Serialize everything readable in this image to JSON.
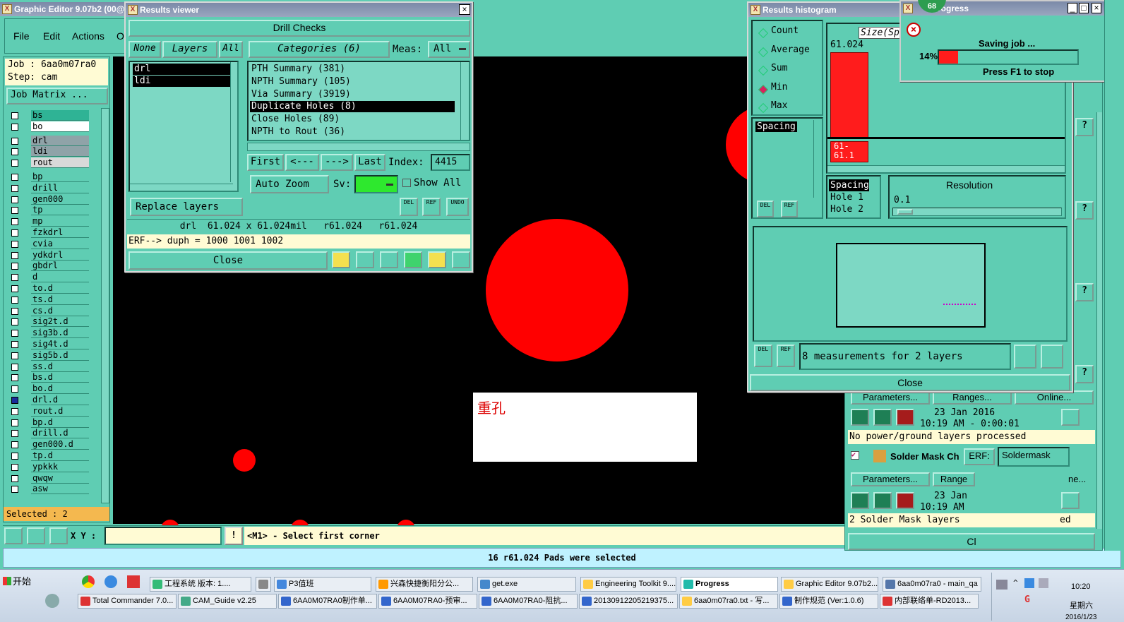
{
  "editor": {
    "title": "Graphic Editor 9.07b2 (00@",
    "menu": [
      "File",
      "Edit",
      "Actions",
      "O"
    ],
    "job_label": "Job : 6aa0m07ra0",
    "step_label": "Step: cam",
    "job_matrix": "Job Matrix ...",
    "layers": [
      "bs",
      "bo",
      "drl",
      "ldi",
      "rout",
      "bp",
      "drill",
      "gen000",
      "tp",
      "mp",
      "fzkdrl",
      "cvia",
      "ydkdrl",
      "gbdrl",
      "d",
      "to.d",
      "ts.d",
      "cs.d",
      "sig2t.d",
      "sig3b.d",
      "sig4t.d",
      "sig5b.d",
      "ss.d",
      "bs.d",
      "bo.d",
      "drl.d",
      "rout.d",
      "bp.d",
      "drill.d",
      "gen000.d",
      "tp.d",
      "ypkkk",
      "qwqw",
      "asw"
    ],
    "selected": "Selected : 2",
    "xy_label": "X Y :",
    "prompt": "<M1> - Select first corner",
    "status": "16 r61.024 Pads were selected",
    "note_text": "重孔"
  },
  "results_viewer": {
    "title": "Results viewer",
    "header": "Drill Checks",
    "none": "None",
    "layers_btn": "Layers",
    "all": "All",
    "categories_btn": "Categories (6)",
    "meas_label": "Meas:",
    "meas_value": "All",
    "layer_list": [
      "drl",
      "ldi"
    ],
    "categories": [
      "PTH Summary (381)",
      "NPTH Summary (105)",
      "Via Summary (3919)",
      "Duplicate Holes (8)",
      "Close Holes (89)",
      "NPTH to Rout (36)"
    ],
    "first": "First",
    "prev": "<---",
    "next": "--->",
    "last": "Last",
    "index_label": "Index:",
    "index_value": "4415",
    "auto_zoom": "Auto Zoom",
    "sv_label": "Sv:",
    "show_all": "Show All",
    "replace_layers": "Replace layers",
    "del": "DEL",
    "ref": "REF",
    "undo": "UNDO",
    "info": "drl  61.024 x 61.024mil   r61.024   r61.024",
    "erf": "ERF--> duph = 1000 1001 1002",
    "close": "Close"
  },
  "histogram": {
    "title": "Results histogram",
    "modes": [
      "Count",
      "Average",
      "Sum",
      "Min",
      "Max"
    ],
    "active_mode": "Min",
    "spacing": "Spacing",
    "size_label": "Size(Sp",
    "bar_top": "61.024",
    "bar_label_1": "61-",
    "bar_label_2": "61.1",
    "pair_list": [
      "Spacing",
      "Hole 1",
      "Hole 2"
    ],
    "resolution": "Resolution",
    "res_value": "0.1",
    "measurements": "8 measurements for 2 layers",
    "close": "Close",
    "del": "DEL",
    "ref": "REF"
  },
  "progress": {
    "title": "Progress",
    "badge": "68",
    "saving": "Saving job ...",
    "percent": "14%",
    "percent_value": 14,
    "stop": "Press F1 to stop"
  },
  "toolkit": {
    "parameters": "Parameters...",
    "ranges": "Ranges...",
    "online": "Online...",
    "date": "23 Jan 2016",
    "time": "10:19 AM - 0:00:01",
    "msg1": "No power/ground layers processed",
    "solder": "Solder Mask Ch",
    "erf": "ERF:",
    "soldermask": "Soldermask",
    "ranges2": "Range",
    "online2": "ne...",
    "date2": "23 Jan",
    "time2": "10:19 AM",
    "msg2": "2 Solder Mask layers",
    "msg2b": "ed",
    "cl": "Cl",
    "q": "?"
  },
  "taskbar": {
    "start": "开始",
    "row1": [
      "工程系统  版本: 1....",
      "",
      "P3值班",
      "兴森快捷衡阳分公...",
      "get.exe",
      "Engineering Toolkit 9....",
      "Progress",
      "Graphic Editor 9.07b2...",
      "6aa0m07ra0 - main_qa"
    ],
    "row2": [
      "Total Commander 7.0...",
      "CAM_Guide v2.25",
      "6AA0M07RA0制作单...",
      "6AA0M07RA0-预审...",
      "6AA0M07RA0-阻抗...",
      "20130912205219375...",
      "6aa0m07ra0.txt - 写...",
      "制作规范 (Ver:1.0.6)",
      "内部联络单-RD2013..."
    ],
    "clock": "10:20",
    "weekday": "星期六",
    "date_partial": "2016/1/23"
  }
}
